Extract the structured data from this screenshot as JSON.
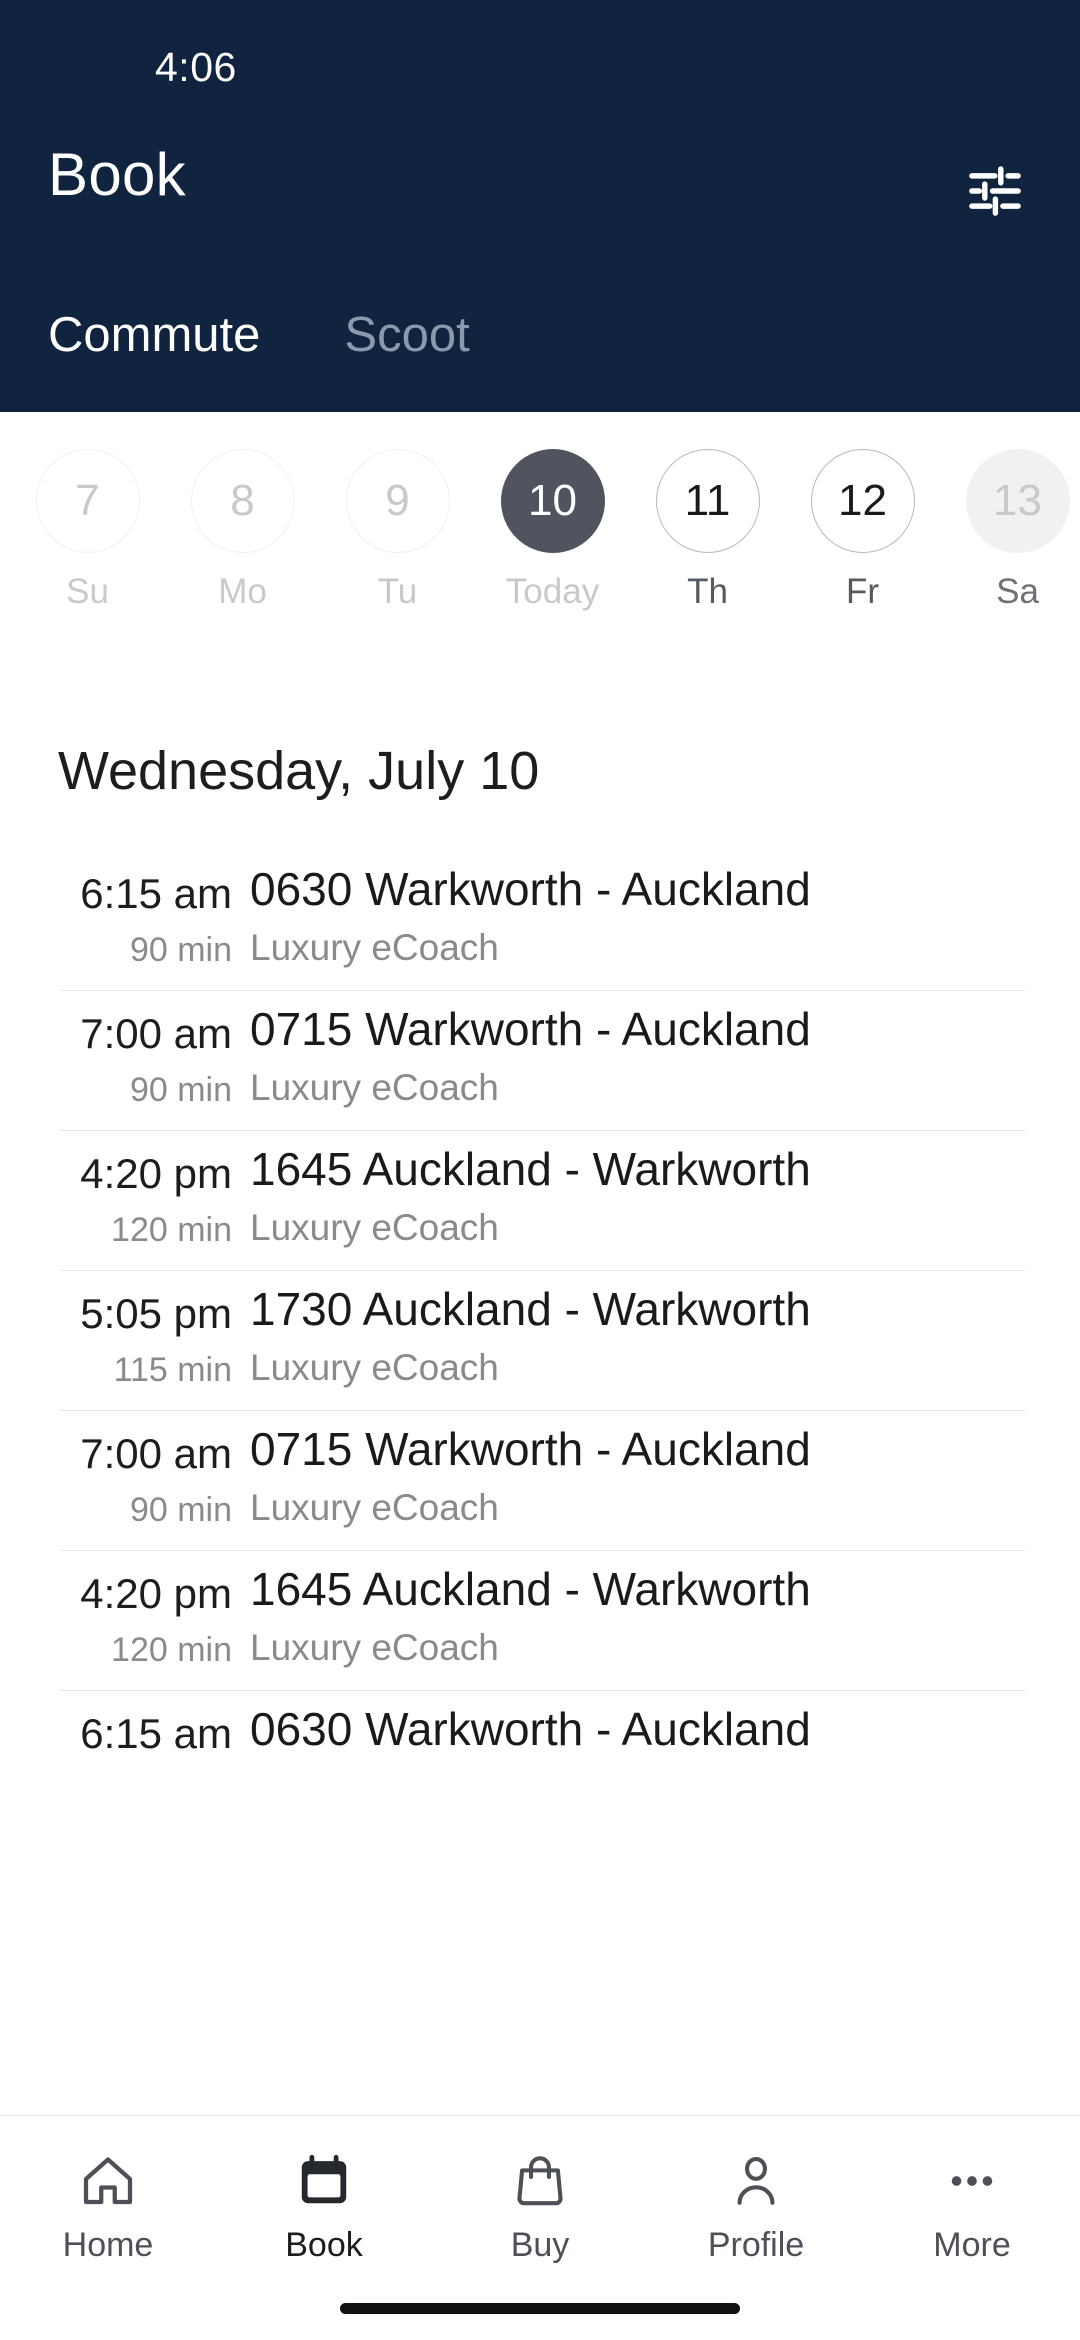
{
  "status_bar": {
    "time": "4:06"
  },
  "app_bar": {
    "title": "Book",
    "filter_icon": "tune-icon"
  },
  "tabs": [
    {
      "label": "Commute",
      "active": true
    },
    {
      "label": "Scoot",
      "active": false
    }
  ],
  "date_strip": [
    {
      "day": "7",
      "weekday": "Su",
      "state": "past"
    },
    {
      "day": "8",
      "weekday": "Mo",
      "state": "past"
    },
    {
      "day": "9",
      "weekday": "Tu",
      "state": "past"
    },
    {
      "day": "10",
      "weekday": "Today",
      "state": "selected"
    },
    {
      "day": "11",
      "weekday": "Th",
      "state": "available"
    },
    {
      "day": "12",
      "weekday": "Fr",
      "state": "available"
    },
    {
      "day": "13",
      "weekday": "Sa",
      "state": "dim"
    }
  ],
  "day_heading": "Wednesday, July 10",
  "trips": [
    {
      "time": "6:15 am",
      "duration": "90 min",
      "name": "0630 Warkworth - Auckland",
      "service": "Luxury eCoach"
    },
    {
      "time": "7:00 am",
      "duration": "90 min",
      "name": "0715 Warkworth - Auckland",
      "service": "Luxury eCoach"
    },
    {
      "time": "4:20 pm",
      "duration": "120 min",
      "name": "1645 Auckland - Warkworth",
      "service": "Luxury eCoach"
    },
    {
      "time": "5:05 pm",
      "duration": "115 min",
      "name": "1730 Auckland - Warkworth",
      "service": "Luxury eCoach"
    },
    {
      "time": "7:00 am",
      "duration": "90 min",
      "name": "0715 Warkworth - Auckland",
      "service": "Luxury eCoach"
    },
    {
      "time": "4:20 pm",
      "duration": "120 min",
      "name": "1645 Auckland - Warkworth",
      "service": "Luxury eCoach"
    },
    {
      "time": "6:15 am",
      "duration": "",
      "name": "0630 Warkworth - Auckland",
      "service": ""
    }
  ],
  "bottom_nav": [
    {
      "label": "Home",
      "icon": "home-icon",
      "active": false
    },
    {
      "label": "Book",
      "icon": "calendar-icon",
      "active": true
    },
    {
      "label": "Buy",
      "icon": "bag-icon",
      "active": false
    },
    {
      "label": "Profile",
      "icon": "person-icon",
      "active": false
    },
    {
      "label": "More",
      "icon": "ellipsis-icon",
      "active": false
    }
  ],
  "colors": {
    "header_navy": "#10243f",
    "selected_date": "#4f545e",
    "muted_text": "#8a8a8a",
    "primary_text": "#1a1a1a"
  }
}
